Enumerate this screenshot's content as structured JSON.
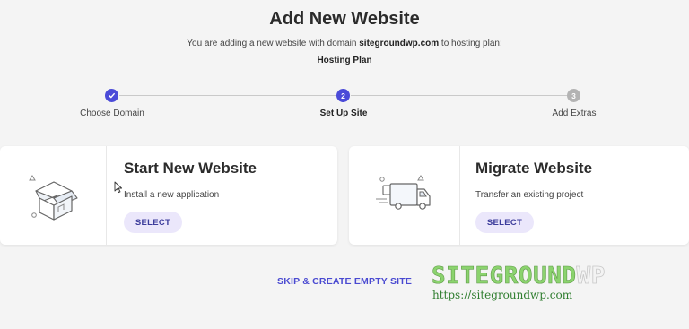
{
  "header": {
    "title": "Add New Website",
    "subtitle_prefix": "You are adding a new website with domain ",
    "domain": "sitegroundwp.com",
    "subtitle_suffix": " to hosting plan:",
    "plan": "Hosting Plan"
  },
  "stepper": {
    "steps": [
      {
        "number": "2",
        "label": "Set Up Site",
        "state": "active"
      },
      {
        "number": "3",
        "label": "Add Extras",
        "state": "pending"
      },
      {
        "label": "Choose Domain",
        "state": "done",
        "icon": "check-icon"
      }
    ],
    "colors": {
      "done": "#4b4bd8",
      "active": "#4b4bd8",
      "pending": "#b3b3b3"
    }
  },
  "cards": {
    "start": {
      "title": "Start New Website",
      "description": "Install a new application",
      "button": "SELECT",
      "icon": "box-house-illustration"
    },
    "migrate": {
      "title": "Migrate Website",
      "description": "Transfer an existing project",
      "button": "SELECT",
      "icon": "delivery-truck-illustration"
    }
  },
  "actions": {
    "skip": "SKIP & CREATE EMPTY SITE"
  },
  "watermark": {
    "brand": "SITEGROUND",
    "suffix": "WP",
    "url": "https://sitegroundwp.com"
  },
  "colors": {
    "accent": "#4b4bd8",
    "button_bg": "#ebe7fb",
    "background": "#f4f4f4",
    "watermark_green": "#8bd36e"
  }
}
